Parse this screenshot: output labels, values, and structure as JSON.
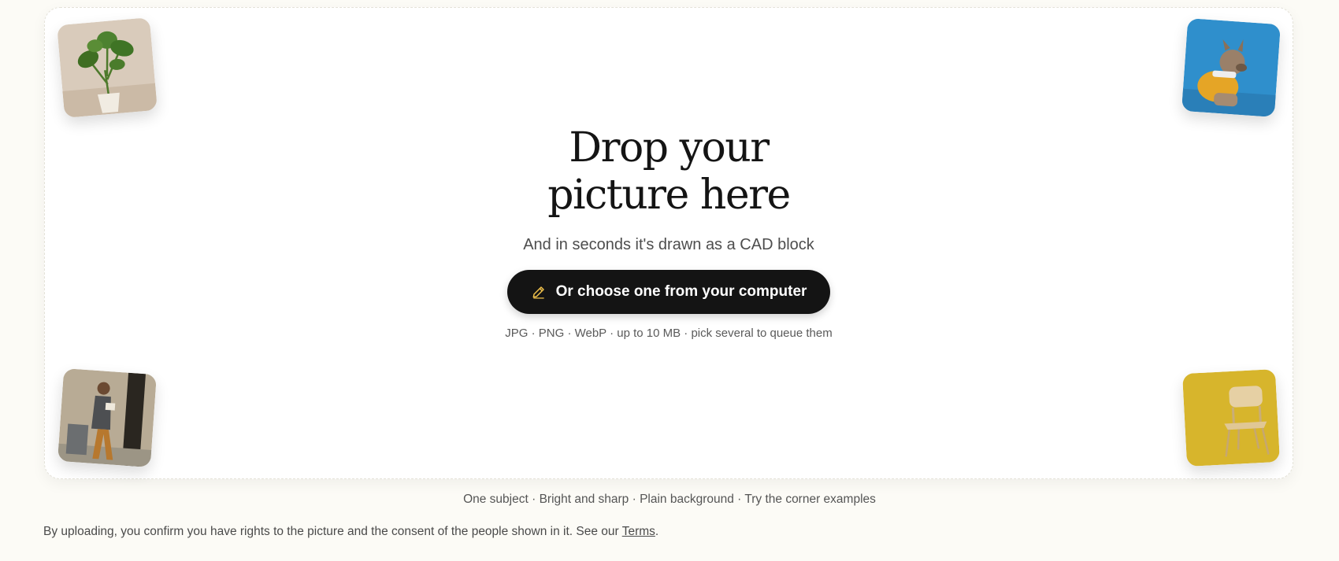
{
  "dropzone": {
    "title_line1": "Drop your",
    "title_line2": "picture here",
    "subtitle": "And in seconds it's drawn as a CAD block",
    "choose_button": "Or choose one from your computer",
    "choose_button_icon": "pencil-icon",
    "formats": "JPG · PNG · WebP · up to 10 MB · pick several to queue them",
    "examples": [
      "plant",
      "dog",
      "man-reading",
      "chair"
    ]
  },
  "tips": "One subject · Bright and sharp · Plain background · Try the corner examples",
  "consent": {
    "text": "By uploading, you confirm you have rights to the picture and the consent of the people shown in it. See our ",
    "link": "Terms",
    "suffix": "."
  },
  "colors": {
    "page_bg": "#fcfbf6",
    "button_bg": "#141414",
    "button_icon": "#f0c14b"
  }
}
